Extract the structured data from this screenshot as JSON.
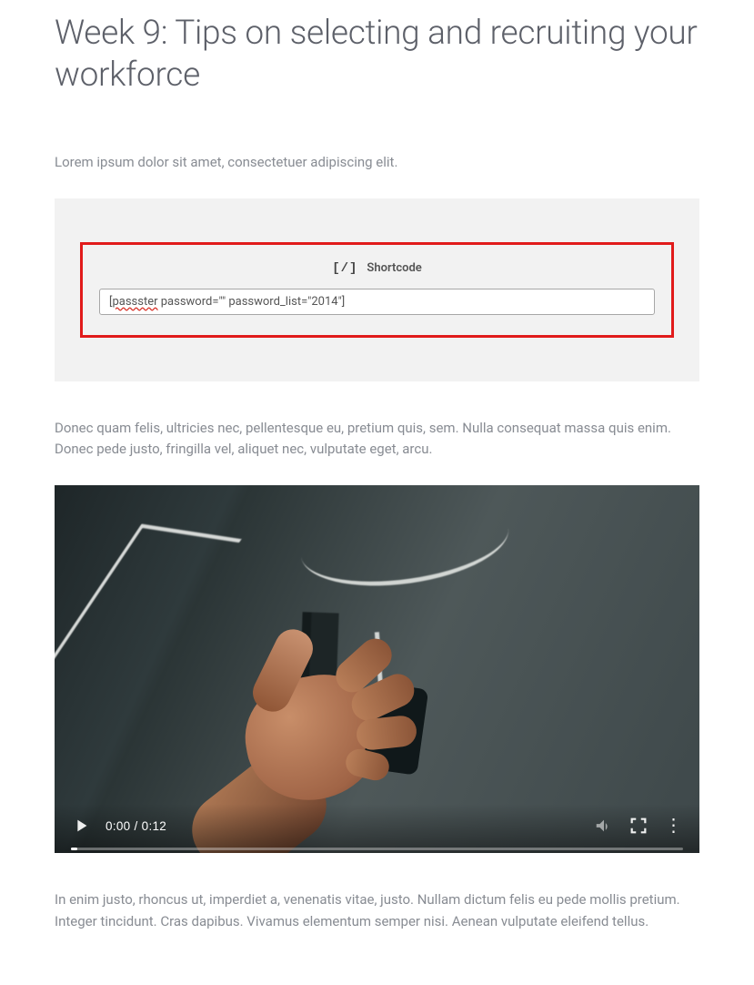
{
  "title": "Week 9: Tips on selecting and recruiting your workforce",
  "intro": "Lorem ipsum dolor sit amet, consectetuer adipiscing elit.",
  "block": {
    "icon_label": "[/]",
    "label": "Shortcode",
    "value_misspelled": "passster",
    "value_rest": " password=\"\" password_list=\"2014\"]"
  },
  "para2": "Donec quam felis, ultricies nec, pellentesque eu, pretium quis, sem. Nulla consequat massa quis enim. Donec pede justo, fringilla vel, aliquet nec, vulputate eget, arcu.",
  "video": {
    "current": "0:00",
    "sep": " / ",
    "total": "0:12"
  },
  "para3": "In enim justo, rhoncus ut, imperdiet a, venenatis vitae, justo. Nullam dictum felis eu pede mollis pretium. Integer tincidunt. Cras dapibus. Vivamus elementum semper nisi. Aenean vulputate eleifend tellus."
}
